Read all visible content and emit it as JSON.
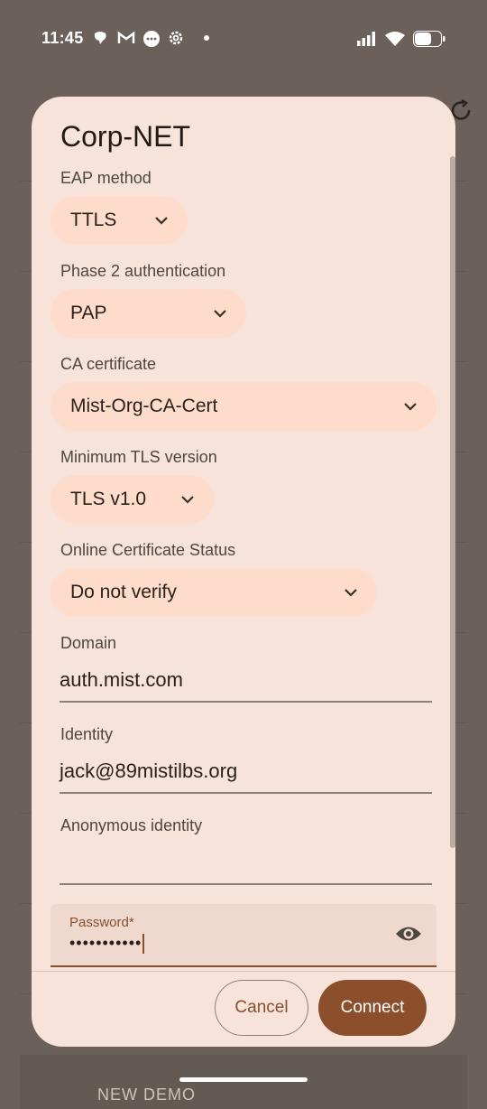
{
  "status_bar": {
    "time": "11:45",
    "left_icons": [
      "chat-bubble-icon",
      "gmail-icon",
      "messages-icon",
      "settings-icon",
      "dot-icon"
    ],
    "right_icons": [
      "signal-icon",
      "wifi-icon",
      "battery-icon"
    ]
  },
  "dialog": {
    "title": "Corp-NET",
    "eap_method": {
      "label": "EAP method",
      "value": "TTLS"
    },
    "phase2": {
      "label": "Phase 2 authentication",
      "value": "PAP"
    },
    "ca_cert": {
      "label": "CA certificate",
      "value": "Mist-Org-CA-Cert"
    },
    "min_tls": {
      "label": "Minimum TLS version",
      "value": "TLS v1.0"
    },
    "ocsp": {
      "label": "Online Certificate Status",
      "value": "Do not verify"
    },
    "domain": {
      "label": "Domain",
      "value": "auth.mist.com"
    },
    "identity": {
      "label": "Identity",
      "value": "jack@89mistilbs.org"
    },
    "anon_identity": {
      "label": "Anonymous identity",
      "value": ""
    },
    "password": {
      "label": "Password*",
      "value": "•••••••••••"
    },
    "cancel_label": "Cancel",
    "connect_label": "Connect"
  },
  "background": {
    "title_partial": "NEW DEMO"
  },
  "colors": {
    "accent": "#8b4f2c",
    "dropdown_bg": "#fddccb",
    "dialog_bg": "#f7e3d9"
  }
}
